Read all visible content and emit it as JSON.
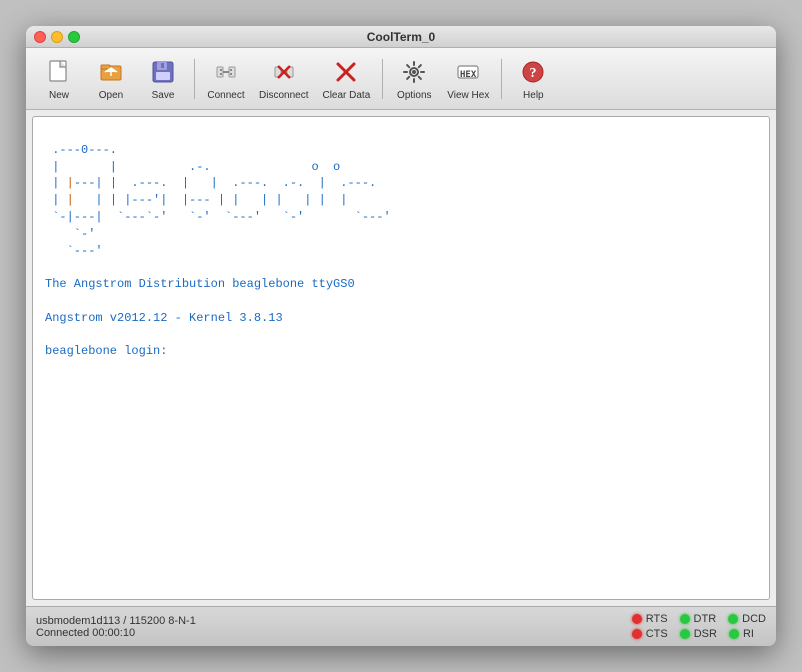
{
  "window": {
    "title": "CoolTerm_0"
  },
  "toolbar": {
    "buttons": [
      {
        "id": "new",
        "label": "New",
        "icon": "new-doc"
      },
      {
        "id": "open",
        "label": "Open",
        "icon": "open-folder"
      },
      {
        "id": "save",
        "label": "Save",
        "icon": "save-disk"
      },
      {
        "id": "connect",
        "label": "Connect",
        "icon": "connect-plug"
      },
      {
        "id": "disconnect",
        "label": "Disconnect",
        "icon": "disconnect-x"
      },
      {
        "id": "clear-data",
        "label": "Clear Data",
        "icon": "clear-eraser"
      },
      {
        "id": "options",
        "label": "Options",
        "icon": "options-gear"
      },
      {
        "id": "view-hex",
        "label": "View Hex",
        "icon": "hex-box"
      },
      {
        "id": "help",
        "label": "Help",
        "icon": "help-circle"
      }
    ]
  },
  "terminal": {
    "ascii_art_lines": [
      " .---0---.",
      " |       |          .-.              o  o",
      " | |---| |  .---.  |   |  .---.  .-.  |  .---.",
      " | |   | | |---'|  |--- | |   | |   | |  |",
      " `-|---|  `---`-'   `-'  `---'   `-'       `---'",
      "    `-'",
      "   `---'"
    ],
    "lines": [
      "The Angstrom Distribution beaglebone ttyGS0",
      "",
      "Angstrom v2012.12 - Kernel 3.8.13",
      "",
      "beaglebone login:"
    ]
  },
  "statusbar": {
    "connection_info": "usbmodem1d113 / 115200 8-N-1",
    "connected_time": "Connected 00:00:10",
    "indicators": [
      {
        "label": "RTS",
        "state": "red"
      },
      {
        "label": "DTR",
        "state": "green"
      },
      {
        "label": "DCD",
        "state": "green"
      },
      {
        "label": "CTS",
        "state": "red"
      },
      {
        "label": "DSR",
        "state": "green"
      },
      {
        "label": "RI",
        "state": "green"
      }
    ]
  }
}
